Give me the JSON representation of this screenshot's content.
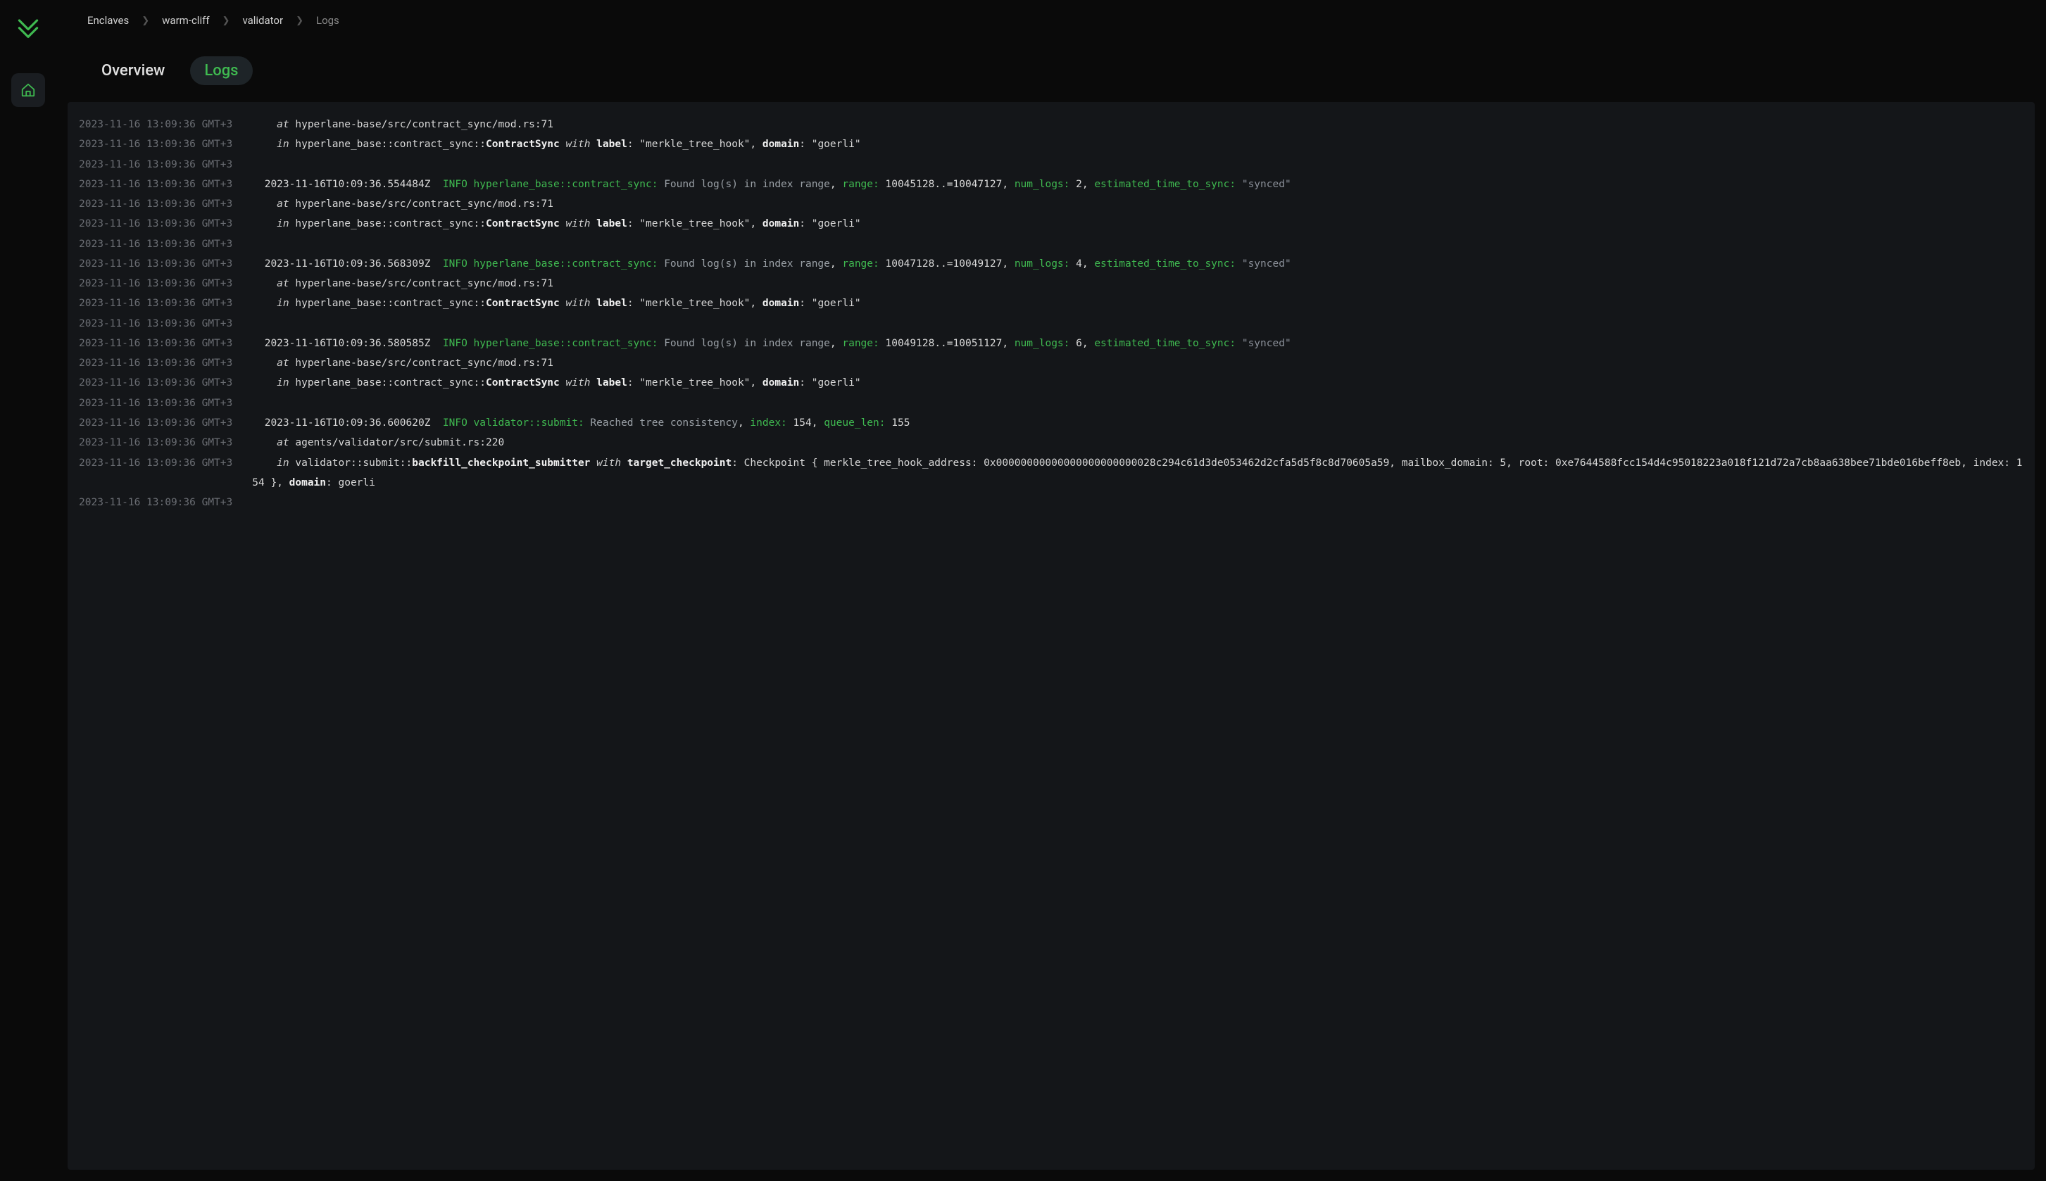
{
  "breadcrumb": {
    "items": [
      "Enclaves",
      "warm-cliff",
      "validator",
      "Logs"
    ]
  },
  "tabs": {
    "overview": "Overview",
    "logs": "Logs"
  },
  "ts": "2023-11-16 13:09:36 GMT+3",
  "kw": {
    "at": "at",
    "in": "in",
    "with": "with",
    "info": "INFO"
  },
  "src": {
    "contract_sync": "hyperlane-base/src/contract_sync/mod.rs:71",
    "submit": "agents/validator/src/submit.rs:220"
  },
  "ctx": {
    "prefix": "hyperlane_base::contract_sync::",
    "contract_sync": "ContractSync",
    "label_k": "label",
    "label_v": "\"merkle_tree_hook\"",
    "domain_k": "domain",
    "domain_v": "\"goerli\"",
    "colon": ":",
    "comma": ", "
  },
  "bfs": {
    "prefix": "validator::submit::",
    "name": "backfill_checkpoint_submitter",
    "target_k": "target_checkpoint",
    "target_v": "Checkpoint { merkle_tree_hook_address: 0x00000000000000000000000028c294c61d3de053462d2cfa5d5f8c8d70605a59, mailbox_domain: 5, root: 0xe7644588fcc154d4c95018223a018f121d72a7cb8aa638bee71bde016beff8eb, index: 154 }",
    "domain_k": "domain",
    "domain_v": "goerli"
  },
  "found": {
    "module": "hyperlane_base::contract_sync:",
    "msg": "Found log(s) in index range",
    "range_k": "range:",
    "num_k": "num_logs:",
    "est_k": "estimated_time_to_sync:",
    "est_v": "\"synced\""
  },
  "reach": {
    "module": "validator::submit:",
    "msg": "Reached tree consistency",
    "index_k": "index:",
    "qlen_k": "queue_len:"
  },
  "lines": [
    {
      "type": "at",
      "src": "contract_sync"
    },
    {
      "type": "inctx"
    },
    {
      "type": "blank"
    },
    {
      "type": "found",
      "utc": "2023-11-16T10:09:36.554484Z",
      "range": "10045128..=10047127",
      "num": "2"
    },
    {
      "type": "at",
      "src": "contract_sync"
    },
    {
      "type": "inctx"
    },
    {
      "type": "blank"
    },
    {
      "type": "found",
      "utc": "2023-11-16T10:09:36.568309Z",
      "range": "10047128..=10049127",
      "num": "4"
    },
    {
      "type": "at",
      "src": "contract_sync"
    },
    {
      "type": "inctx"
    },
    {
      "type": "blank"
    },
    {
      "type": "found",
      "utc": "2023-11-16T10:09:36.580585Z",
      "range": "10049128..=10051127",
      "num": "6"
    },
    {
      "type": "at",
      "src": "contract_sync"
    },
    {
      "type": "inctx"
    },
    {
      "type": "blank"
    },
    {
      "type": "reach",
      "utc": "2023-11-16T10:09:36.600620Z",
      "index": "154",
      "qlen": "155"
    },
    {
      "type": "at",
      "src": "submit"
    },
    {
      "type": "inbfs"
    },
    {
      "type": "blank"
    }
  ]
}
